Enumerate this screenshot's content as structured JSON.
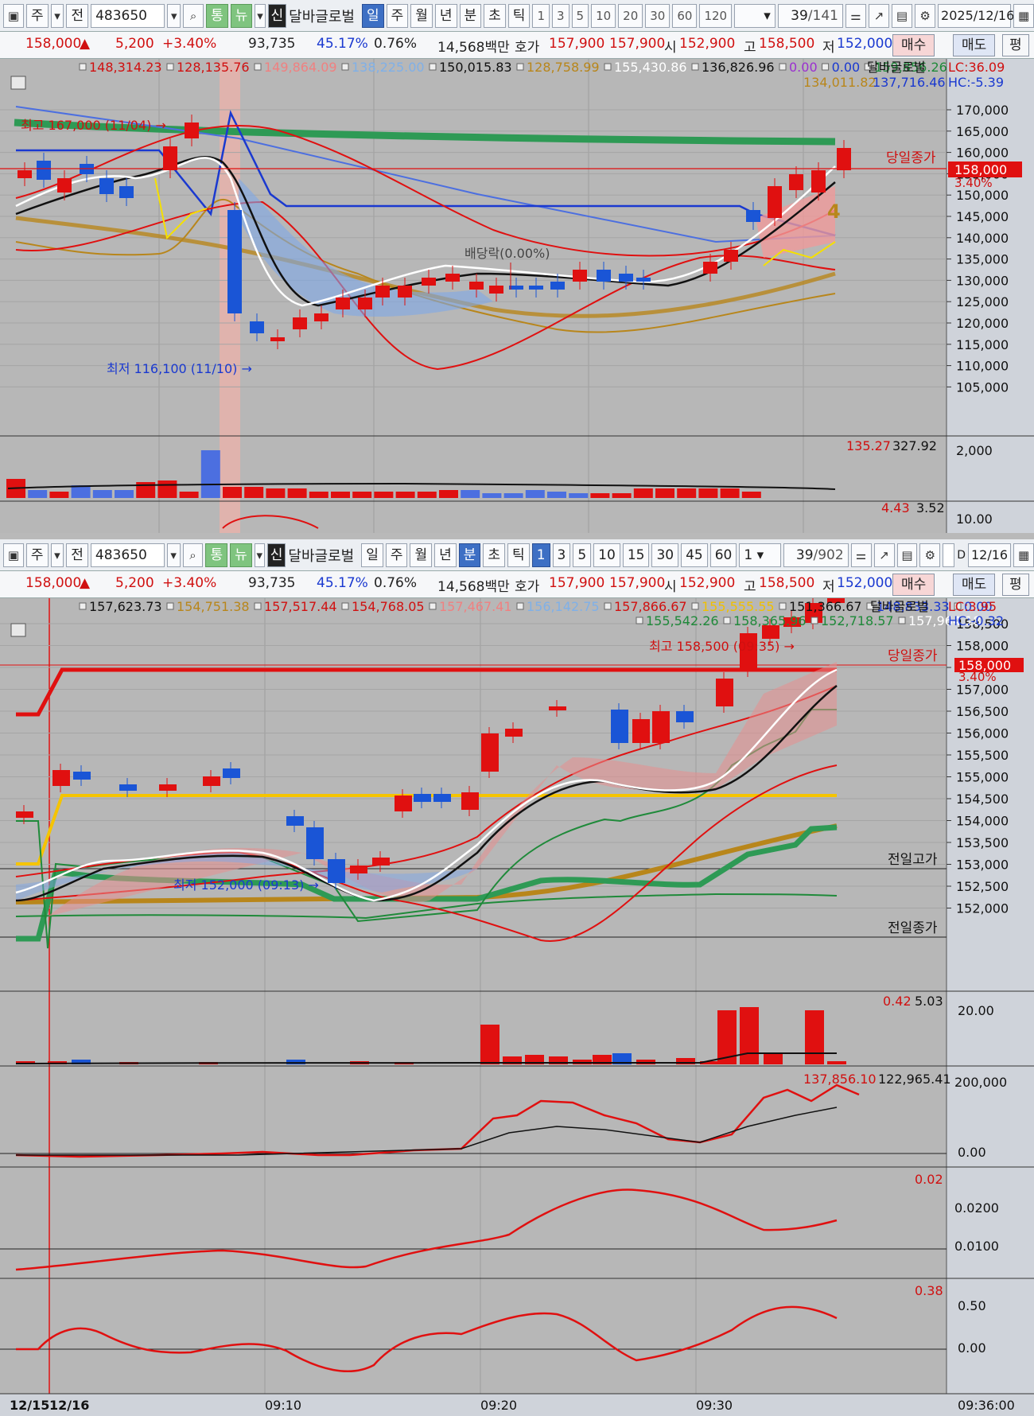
{
  "top": {
    "toolbar": {
      "period": "주",
      "jeon": "전",
      "code": "483650",
      "tong": "통",
      "nyu": "뉴",
      "shin": "신",
      "stock_name": "달바글로벌",
      "periods": [
        "일",
        "주",
        "월",
        "년",
        "분",
        "초",
        "틱"
      ],
      "selected_period": "일",
      "nums": [
        "1",
        "3",
        "5",
        "10",
        "20",
        "30",
        "60",
        "120"
      ],
      "count": "39",
      "total": "/141",
      "date": "2025/12/16"
    },
    "quote": {
      "price": "158,000",
      "arrow": "▲",
      "change": "5,200",
      "rate": "+3.40%",
      "volume": "93,735",
      "turnover": "45.17%",
      "pct": "0.76%",
      "amount": "14,568백만",
      "hoga_label": "호가",
      "ask": "157,900",
      "bid": "157,900",
      "si_label": "시",
      "open": "152,900",
      "go_label": "고",
      "high": "158,500",
      "jeo_label": "저",
      "low": "152,000",
      "buy": "매수",
      "sell": "매도",
      "pyeong": "평"
    },
    "chart": {
      "legend1": [
        "148,314.23",
        "128,135.76",
        "149,864.09",
        "138,225.00",
        "150,015.83",
        "128,758.99",
        "155,430.86",
        "136,826.96",
        "0.00",
        "0.00",
        "159,856.26"
      ],
      "legend1_colors": [
        "#d01010",
        "#d01010",
        "#f08080",
        "#7fb0e8",
        "#111111",
        "#b8861b",
        "#ffffff",
        "#111111",
        "#9b30d0",
        "#1a39d0",
        "#1f8a3a"
      ],
      "legend_name": "달바글로벌",
      "lc": "LC:36.09",
      "hc": "HC:-5.39",
      "legend2": [
        "134,011.82",
        "137,716.46"
      ],
      "legend2_colors": [
        "#b8861b",
        "#1a39d0"
      ],
      "y_ticks": [
        "170,000",
        "165,000",
        "160,000",
        "155,000",
        "150,000",
        "145,000",
        "140,000",
        "135,000",
        "130,000",
        "125,000",
        "120,000",
        "115,000",
        "110,000",
        "105,000"
      ],
      "close_label": "당일종가",
      "last_price": "158,000",
      "last_rate": "3.40%",
      "max_note": "최고 167,000 (11/04) →",
      "min_note": "최저 116,100 (11/10) →",
      "div_note": "배당락(0.00%)",
      "vol_legend": [
        "135.27",
        "327.92"
      ],
      "vol_tick": "2,000",
      "sub_legend": [
        "4.43",
        "3.52"
      ],
      "sub_tick": "10.00"
    }
  },
  "bottom": {
    "toolbar": {
      "period": "주",
      "jeon": "전",
      "code": "483650",
      "tong": "통",
      "nyu": "뉴",
      "shin": "신",
      "stock_name": "달바글로벌",
      "periods": [
        "일",
        "주",
        "월",
        "년",
        "분",
        "초",
        "틱"
      ],
      "selected_period": "분",
      "nums": [
        "1",
        "3",
        "5",
        "10",
        "15",
        "30",
        "45",
        "60"
      ],
      "selected_num": "1",
      "unit": "1",
      "count": "39",
      "total": "/902",
      "d": "D",
      "date": "12/16"
    },
    "chart": {
      "legend1": [
        "157,623.73",
        "154,751.38",
        "157,517.44",
        "154,768.05",
        "157,467.41",
        "156,142.75",
        "157,866.67",
        "155,555.55",
        "151,366.67",
        "148,833.33",
        "0.00"
      ],
      "legend1_colors": [
        "#111111",
        "#b8861b",
        "#d01010",
        "#d01010",
        "#f08080",
        "#7fb0e8",
        "#d01010",
        "#f0c000",
        "#111111",
        "#1a39d0",
        "#1a39d0"
      ],
      "legend_name": "달바글로벌",
      "lc": "LC:3.95",
      "hc": "HC:-0.32",
      "legend2": [
        "155,542.26",
        "158,365.96",
        "152,718.57",
        "157,964.18"
      ],
      "legend2_colors": [
        "#1f8a3a",
        "#1f8a3a",
        "#1f8a3a",
        "#ffffff"
      ],
      "y_ticks": [
        "158,500",
        "158,000",
        "157,500",
        "157,000",
        "156,500",
        "156,000",
        "155,500",
        "155,000",
        "154,500",
        "154,000",
        "153,500",
        "153,000",
        "152,500",
        "152,000"
      ],
      "close_label": "당일종가",
      "prev_high_label": "전일고가",
      "prev_close_label": "전일종가",
      "last_price": "158,000",
      "last_rate": "3.40%",
      "max_note": "최고 158,500 (09:35) →",
      "min_note": "최저 152,000 (09:13) →",
      "vol_legend": [
        "0.42",
        "5.03"
      ],
      "vol_tick": "20.00",
      "obv_legend": [
        "137,856.10",
        "122,965.41"
      ],
      "obv_ticks": [
        "200,000",
        "0.00"
      ],
      "ind2_legend": "0.02",
      "ind2_ticks": [
        "0.0200",
        "0.0100"
      ],
      "ind3_legend": "0.38",
      "ind3_ticks": [
        "0.50",
        "0.00"
      ],
      "x_labels": [
        "12/15",
        "12/16",
        "09:10",
        "09:20",
        "09:30",
        "09:36:00"
      ]
    }
  }
}
